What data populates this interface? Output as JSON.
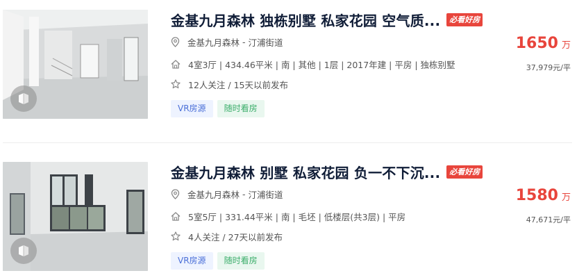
{
  "listings": [
    {
      "title": "金基九月森林 独栋别墅 私家花园 空气质...",
      "hot_tag": "必看好房",
      "community": "金基九月森林",
      "separator": " - ",
      "district": "汀浦街道",
      "details": "4室3厅 | 434.46平米 | 南 | 其他 | 1层 | 2017年建 | 平房 | 独栋别墅",
      "follow": "12人关注 / 15天以前发布",
      "tags": [
        "VR房源",
        "随时看房"
      ],
      "total_price": "1650",
      "total_unit": "万",
      "unit_price": "37,979元/平"
    },
    {
      "title": "金基九月森林 别墅 私家花园 负一不下沉...",
      "hot_tag": "必看好房",
      "community": "金基九月森林",
      "separator": " - ",
      "district": "汀浦街道",
      "details": "5室5厅 | 331.44平米 | 南 | 毛坯 | 低楼层(共3层) | 平房",
      "follow": "4人关注 / 27天以前发布",
      "tags": [
        "VR房源",
        "随时看房"
      ],
      "total_price": "1580",
      "total_unit": "万",
      "unit_price": "47,671元/平"
    }
  ],
  "icons": {
    "location": "location-pin-icon",
    "house": "house-icon",
    "star": "star-icon",
    "vr": "vr-cube-icon"
  },
  "colors": {
    "price": "#e8453c",
    "hot_tag_bg": "#e8453c",
    "title": "#101d37",
    "vr_tag_text": "#4a6fd8",
    "visit_tag_text": "#3cae6b"
  }
}
